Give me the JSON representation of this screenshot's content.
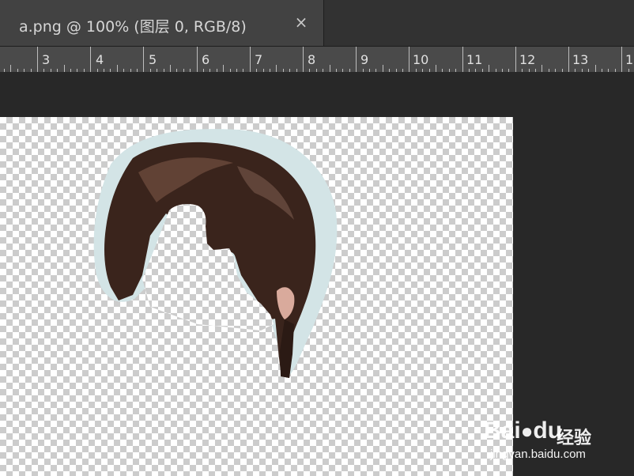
{
  "document_tab": {
    "title": "a.png @ 100% (图层 0, RGB/8)",
    "close_glyph": "×"
  },
  "ruler": {
    "labels": [
      "3",
      "4",
      "5",
      "6",
      "7",
      "8",
      "9",
      "10",
      "11",
      "12",
      "13",
      "1"
    ]
  },
  "canvas": {
    "transparency_pattern": "checkerboard",
    "layer_content": "hair-cutout",
    "colors": {
      "halo": "#d3e4e6",
      "hair_dark": "#2b1a14",
      "hair_mid": "#4a3028",
      "hair_light": "#7a5a4c",
      "skin": "#d9aa9c"
    }
  },
  "watermark": {
    "brand": "Bai",
    "brand_suffix": "du",
    "product": "经验",
    "url": "jingyan.baidu.com"
  },
  "colors": {
    "workspace": "#282828",
    "tab_active": "#424242",
    "tabbar": "#323232",
    "ruler": "#4a4a4a",
    "ruler_text": "#e0e0e0"
  }
}
